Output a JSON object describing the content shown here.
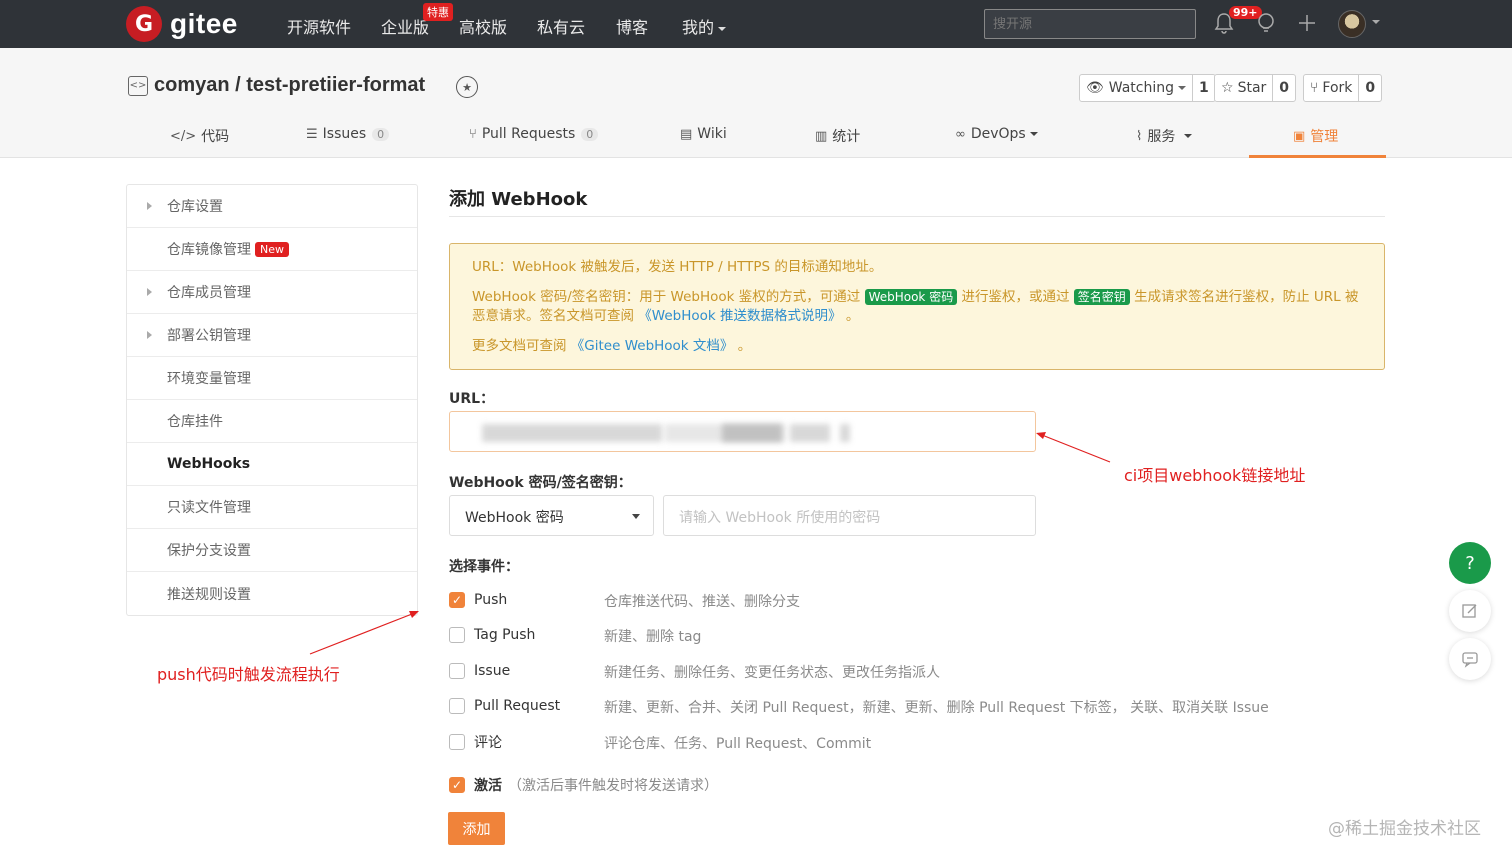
{
  "topnav": {
    "logo_letter": "G",
    "logo_text": "gitee",
    "items": [
      "开源软件",
      "企业版",
      "高校版",
      "私有云",
      "博客",
      "我的"
    ],
    "hot_tag": "特惠",
    "search_placeholder": "搜开源",
    "notification_count": "99+"
  },
  "repo": {
    "title": "comyan / test-pretiier-format",
    "watching_label": "Watching",
    "watching_count": "1",
    "star_label": "Star",
    "star_count": "0",
    "fork_label": "Fork",
    "fork_count": "0"
  },
  "tabs": [
    {
      "label": "代码"
    },
    {
      "label": "Issues",
      "count": "0"
    },
    {
      "label": "Pull Requests",
      "count": "0"
    },
    {
      "label": "Wiki"
    },
    {
      "label": "统计"
    },
    {
      "label": "DevOps"
    },
    {
      "label": "服务"
    },
    {
      "label": "管理"
    }
  ],
  "sidebar": {
    "items": [
      {
        "label": "仓库设置"
      },
      {
        "label": "仓库镜像管理",
        "badge": "New"
      },
      {
        "label": "仓库成员管理"
      },
      {
        "label": "部署公钥管理"
      },
      {
        "label": "环境变量管理"
      },
      {
        "label": "仓库挂件"
      },
      {
        "label": "WebHooks"
      },
      {
        "label": "只读文件管理"
      },
      {
        "label": "保护分支设置"
      },
      {
        "label": "推送规则设置"
      }
    ]
  },
  "main": {
    "title": "添加 WebHook",
    "notice": {
      "line1": "URL：WebHook 被触发后，发送 HTTP / HTTPS 的目标通知地址。",
      "line2_a": "WebHook 密码/签名密钥：用于 WebHook 鉴权的方式，可通过",
      "badge1": "WebHook 密码",
      "line2_b": "进行鉴权，或通过",
      "badge2": "签名密钥",
      "line2_c": "生成请求签名进行鉴权，防止 URL 被恶意请求。签名文档可查阅",
      "link1": "《WebHook 推送数据格式说明》",
      "line2_d": "。",
      "line3_a": "更多文档可查阅",
      "link2": "《Gitee WebHook 文档》",
      "line3_b": "。"
    },
    "url_label": "URL：",
    "secret_label": "WebHook 密码/签名密钥：",
    "secret_type": "WebHook 密码",
    "secret_placeholder": "请输入 WebHook 所使用的密码",
    "events_label": "选择事件：",
    "events": [
      {
        "name": "Push",
        "desc": "仓库推送代码、推送、删除分支",
        "checked": true
      },
      {
        "name": "Tag Push",
        "desc": "新建、删除 tag",
        "checked": false
      },
      {
        "name": "Issue",
        "desc": "新建任务、删除任务、变更任务状态、更改任务指派人",
        "checked": false
      },
      {
        "name": "Pull Request",
        "desc": "新建、更新、合并、关闭 Pull Request，新建、更新、删除 Pull Request 下标签， 关联、取消关联 Issue",
        "checked": false
      },
      {
        "name": "评论",
        "desc": "评论仓库、任务、Pull Request、Commit",
        "checked": false
      }
    ],
    "activate_label": "激活",
    "activate_hint": "（激活后事件触发时将发送请求）",
    "submit_label": "添加"
  },
  "annotations": {
    "url_note": "ci项目webhook链接地址",
    "push_note": "push代码时触发流程执行"
  },
  "fab": {
    "help": "?"
  },
  "watermark": "@稀土掘金技术社区",
  "colors": {
    "accent": "#f0833a",
    "nav_bg": "#2f3338",
    "brand_red": "#c71d23",
    "green": "#1a9a4a"
  }
}
